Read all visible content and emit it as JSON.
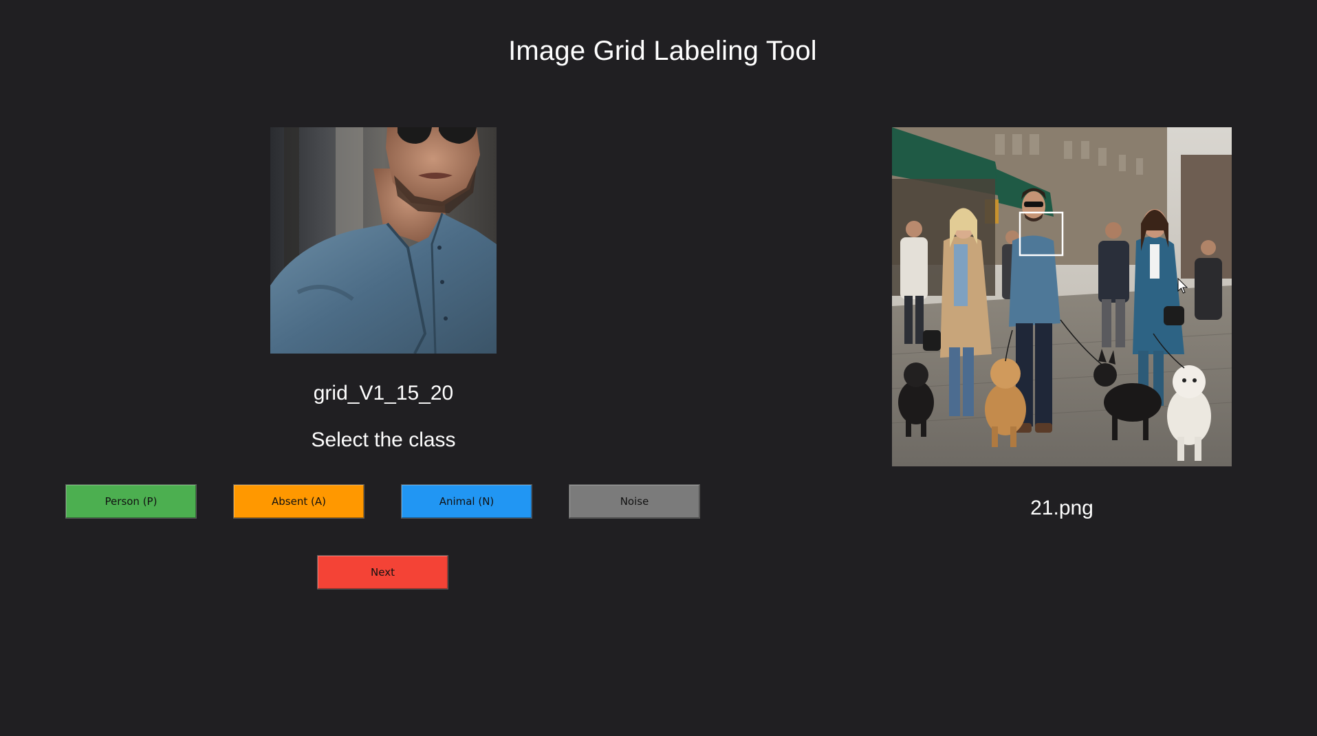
{
  "app": {
    "title": "Image Grid Labeling Tool"
  },
  "crop_panel": {
    "grid_name": "grid_V1_15_20",
    "prompt": "Select the class"
  },
  "buttons": {
    "person": "Person (P)",
    "absent": "Absent (A)",
    "animal": "Animal (N)",
    "noise": "Noise",
    "next": "Next"
  },
  "source_panel": {
    "filename": "21.png"
  },
  "colors": {
    "background": "#201f22",
    "person": "#4caf50",
    "absent": "#ff9800",
    "animal": "#2196f3",
    "noise": "#7b7b7b",
    "next": "#f44336"
  }
}
